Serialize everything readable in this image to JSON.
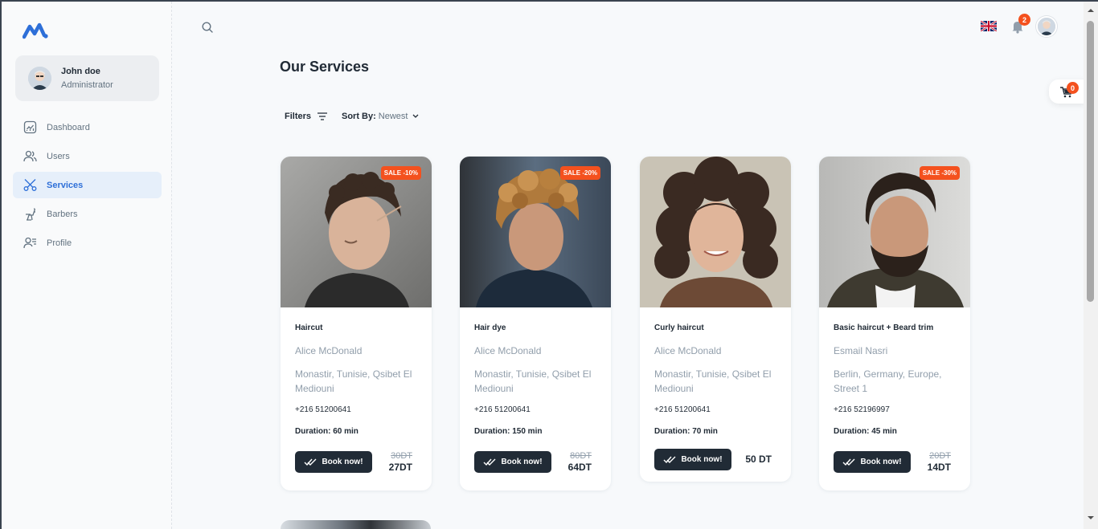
{
  "user": {
    "name": "John doe",
    "role": "Administrator"
  },
  "nav": [
    {
      "label": "Dashboard",
      "icon": "dashboard-icon",
      "active": false
    },
    {
      "label": "Users",
      "icon": "users-icon",
      "active": false
    },
    {
      "label": "Services",
      "icon": "scissors-icon",
      "active": true
    },
    {
      "label": "Barbers",
      "icon": "barber-chair-icon",
      "active": false
    },
    {
      "label": "Profile",
      "icon": "profile-icon",
      "active": false
    }
  ],
  "header": {
    "notifications_count": "2",
    "language_icon": "uk-flag-icon"
  },
  "page": {
    "title": "Our Services"
  },
  "toolbar": {
    "filters_label": "Filters",
    "sort_label": "Sort By:",
    "sort_value": "Newest"
  },
  "cart": {
    "count": "0"
  },
  "services": [
    {
      "sale": "SALE -10%",
      "title": "Haircut",
      "barber": "Alice McDonald",
      "address": "Monastir, Tunisie, Qsibet El Mediouni",
      "phone": "+216 51200641",
      "duration": "Duration: 60 min",
      "book_label": "Book now!",
      "old_price": "30DT",
      "price": "27DT"
    },
    {
      "sale": "SALE -20%",
      "title": "Hair dye",
      "barber": "Alice McDonald",
      "address": "Monastir, Tunisie, Qsibet El Mediouni",
      "phone": "+216 51200641",
      "duration": "Duration: 150 min",
      "book_label": "Book now!",
      "old_price": "80DT",
      "price": "64DT"
    },
    {
      "sale": "",
      "title": "Curly haircut",
      "barber": "Alice McDonald",
      "address": "Monastir, Tunisie, Qsibet El Mediouni",
      "phone": "+216 51200641",
      "duration": "Duration: 70 min",
      "book_label": "Book now!",
      "old_price": "",
      "price": "50 DT"
    },
    {
      "sale": "SALE -30%",
      "title": "Basic haircut + Beard trim",
      "barber": "Esmail Nasri",
      "address": "Berlin, Germany, Europe, Street 1",
      "phone": "+216 52196997",
      "duration": "Duration: 45 min",
      "book_label": "Book now!",
      "old_price": "20DT",
      "price": "14DT"
    }
  ],
  "colors": {
    "accent": "#2e6fd8",
    "sale": "#f4511e",
    "dark": "#212b36",
    "muted": "#919eab"
  }
}
